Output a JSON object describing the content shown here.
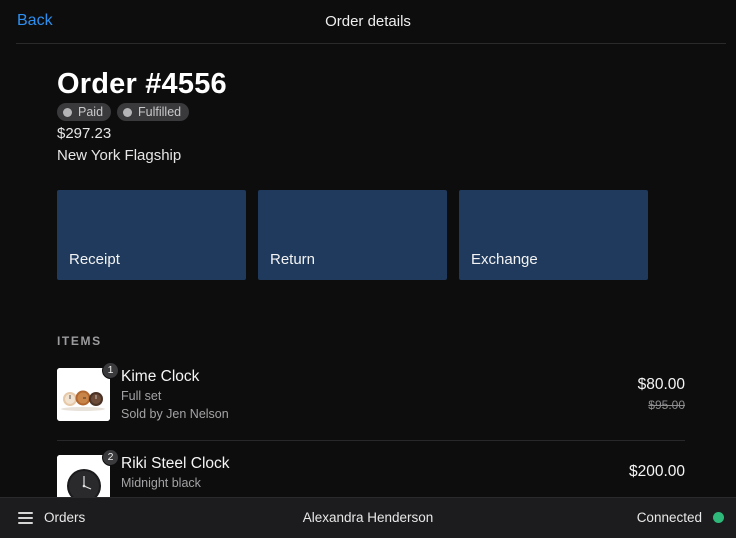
{
  "nav": {
    "back_label": "Back",
    "title": "Order details"
  },
  "order": {
    "title": "Order #4556",
    "badges": [
      "Paid",
      "Fulfilled"
    ],
    "total": "$297.23",
    "location": "New York Flagship"
  },
  "actions": [
    "Receipt",
    "Return",
    "Exchange"
  ],
  "items_heading": "ITEMS",
  "items": [
    {
      "quantity": "1",
      "name": "Kime Clock",
      "variant": "Full set",
      "seller": "Sold by Jen Nelson",
      "price": "$80.00",
      "original_price": "$95.00",
      "thumbnail": "wood-clocks-image"
    },
    {
      "quantity": "2",
      "name": "Riki Steel Clock",
      "variant": "Midnight black",
      "price": "$200.00",
      "thumbnail": "black-clock-image"
    }
  ],
  "bottom_bar": {
    "menu_label": "Orders",
    "user_name": "Alexandra Henderson",
    "status": "Connected",
    "status_color": "#2eb87a"
  },
  "colors": {
    "accent": "#2d8ff0",
    "tile": "#1f3a5c"
  }
}
